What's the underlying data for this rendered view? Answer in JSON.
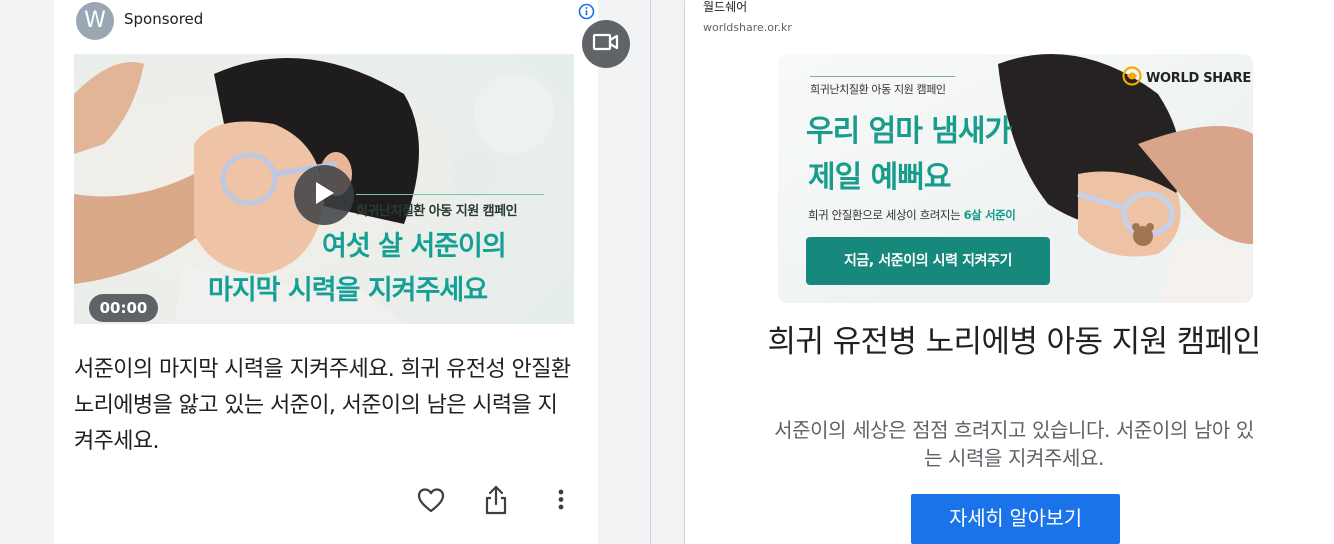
{
  "left_ad": {
    "avatar_letter": "W",
    "sponsored_label": "Sponsored",
    "video": {
      "kicker": "희귀난치질환 아동 지원 캠페인",
      "headline_line1": "여섯 살 서준이의",
      "headline_line2": "마지막 시력을 지켜주세요",
      "timestamp": "00:00"
    },
    "body_text": "서준이의 마지막 시력을 지켜주세요. 희귀 유전성 안질환 노리에병을 앓고 있는 서준이, 서준이의 남은 시력을 지켜주세요."
  },
  "right_ad": {
    "advertiser": "월드쉐어",
    "domain": "worldshare.or.kr",
    "banner": {
      "logo_text": "WORLD SHARE",
      "kicker": "희귀난치질환 아동 지원 캠페인",
      "headline_line1": "우리 엄마 냄새가",
      "headline_line2": "제일 예뻐요",
      "subline": "희귀 안질환으로 세상이 흐려지는",
      "subline_accent": "6살 서준이",
      "cta": "지금, 서준이의 시력 지켜주기"
    },
    "title": "희귀 유전병 노리에병 아동 지원 캠페인",
    "description": "서준이의 세상은 점점 흐려지고 있습니다. 서준이의 남아 있는 시력을 지켜주세요.",
    "button_label": "자세히 알아보기"
  },
  "colors": {
    "teal_headline": "#14a095",
    "cta_teal": "#17887c",
    "learn_more_blue": "#1a73e8",
    "info_blue": "#1a73e8"
  },
  "icons": [
    "info-icon",
    "video-camera-icon",
    "play-icon",
    "heart-icon",
    "share-icon",
    "more-vert-icon",
    "world-share-logo-icon"
  ]
}
